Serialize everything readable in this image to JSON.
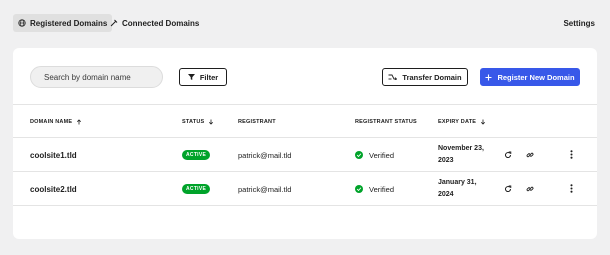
{
  "nav": {
    "tabs": [
      {
        "label": "Registered Domains",
        "icon": "globe-icon",
        "active": true
      },
      {
        "label": "Connected Domains",
        "icon": "plug-icon",
        "active": false
      }
    ],
    "settings_label": "Settings"
  },
  "toolbar": {
    "search_placeholder": "Search by domain name",
    "filter_label": "Filter",
    "transfer_label": "Transfer Domain",
    "register_label": "Register New Domain"
  },
  "table": {
    "columns": {
      "domain_name": "DOMAIN NAME",
      "status": "STATUS",
      "registrant": "REGISTRANT",
      "registrant_status": "REGISTRANT STATUS",
      "expiry_date": "EXPIRY DATE"
    },
    "rows": [
      {
        "domain": "coolsite1.tld",
        "status": "ACTIVE",
        "registrant": "patrick@mail.tld",
        "registrant_status": "Verified",
        "expiry": "November 23, 2023"
      },
      {
        "domain": "coolsite2.tld",
        "status": "ACTIVE",
        "registrant": "patrick@mail.tld",
        "registrant_status": "Verified",
        "expiry": "January 31, 2024"
      }
    ]
  },
  "colors": {
    "primary": "#3858e9",
    "success": "#00a32a",
    "background": "#f0f0f1"
  }
}
